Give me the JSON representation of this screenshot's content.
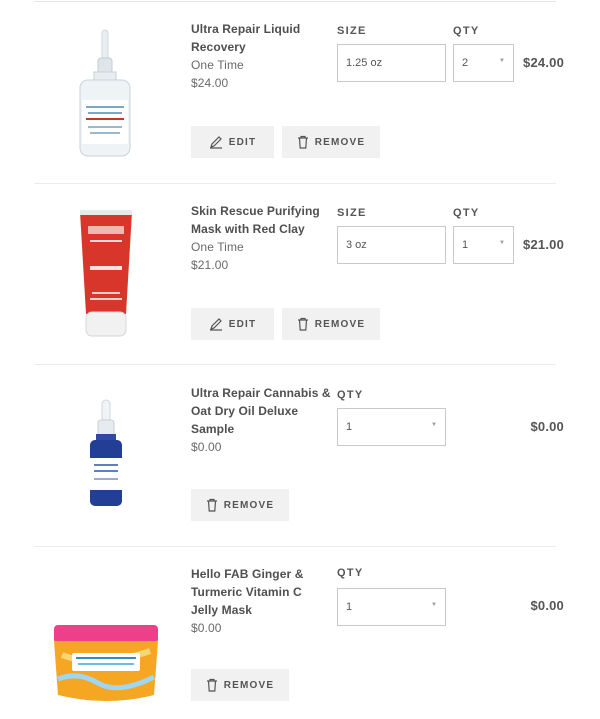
{
  "labels": {
    "size": "SIZE",
    "qty": "QTY"
  },
  "buttons": {
    "edit": "EDIT",
    "remove": "REMOVE"
  },
  "items": [
    {
      "name": "Ultra Repair Liquid Recovery",
      "frequency": "One Time",
      "unit_price": "$24.00",
      "size": "1.25 oz",
      "qty": "2",
      "total": "$24.00"
    },
    {
      "name": "Skin Rescue Purifying Mask with Red Clay",
      "frequency": "One Time",
      "unit_price": "$21.00",
      "size": "3 oz",
      "qty": "1",
      "total": "$21.00"
    },
    {
      "name": "Ultra Repair Cannabis & Oat Dry Oil Deluxe Sample",
      "unit_price": "$0.00",
      "qty": "1",
      "total": "$0.00"
    },
    {
      "name": "Hello FAB Ginger & Turmeric Vitamin C Jelly Mask",
      "unit_price": "$0.00",
      "qty": "1",
      "total": "$0.00"
    }
  ],
  "icons": {
    "edit": "pencil-icon",
    "remove": "trash-icon",
    "caret": "chevron-down-icon"
  },
  "colors": {
    "button_bg": "#f1f1f1",
    "text": "#4a4a4a"
  }
}
